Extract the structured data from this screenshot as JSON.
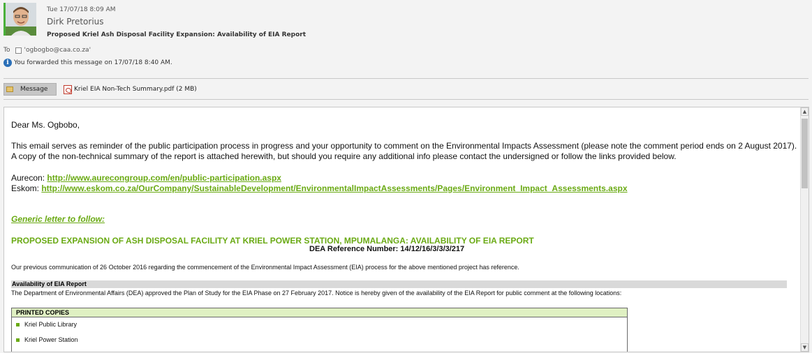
{
  "header": {
    "date": "Tue 17/07/18 8:09 AM",
    "sender": "Dirk Pretorius",
    "subject": "Proposed Kriel Ash Disposal Facility Expansion: Availability of EIA Report",
    "to_label": "To",
    "to_recipient": "'ogbogbo@caa.co.za'",
    "info": "You forwarded this message on 17/07/18 8:40 AM."
  },
  "attachments": {
    "message_tab": "Message",
    "file": "Kriel EIA Non-Tech Summary.pdf (2 MB)"
  },
  "body": {
    "greeting": "Dear Ms. Ogbobo,",
    "para1_line1": "This email serves as reminder of the public participation process in progress and your opportunity to comment on the Environmental Impacts Assessment (please note the comment period ends on 2 August 2017).",
    "para1_line2": "A copy of the non-technical summary of the report is attached herewith, but should you require any additional info please contact the undersigned or follow the links provided below.",
    "aurecon_label": "Aurecon: ",
    "aurecon_link": "http://www.aurecongroup.com/en/public-participation.aspx",
    "eskom_label": "Eskom: ",
    "eskom_link": "http://www.eskom.co.za/OurCompany/SustainableDevelopment/EnvironmentalImpactAssessments/Pages/Environment_Impact_Assessments.aspx",
    "generic": "Generic letter to follow:",
    "heading": "PROPOSED EXPANSION OF ASH DISPOSAL FACILITY AT KRIEL POWER STATION, MPUMALANGA: AVAILABILITY OF EIA REPORT",
    "reference": "DEA Reference Number: 14/12/16/3/3/3/217",
    "previous": "Our previous communication of 26 October 2016 regarding the commencement of the Environmental Impact Assessment (EIA) process for the above mentioned project has reference.",
    "section_title": "Availability of EIA Report",
    "section_text": "The Department of Environmental Affairs (DEA) approved the Plan of Study for the EIA Phase on 27 February 2017. Notice is hereby given of the availability of the EIA Report for public comment at the following locations:",
    "printed_copies": {
      "title": "PRINTED COPIES",
      "items": [
        "Kriel Public Library",
        "Kriel Power Station"
      ]
    }
  },
  "colors": {
    "link_green": "#6aaa14",
    "section_grey": "#d9d9d9",
    "table_header_green": "#dff0c2",
    "info_blue": "#2a6fb7"
  }
}
